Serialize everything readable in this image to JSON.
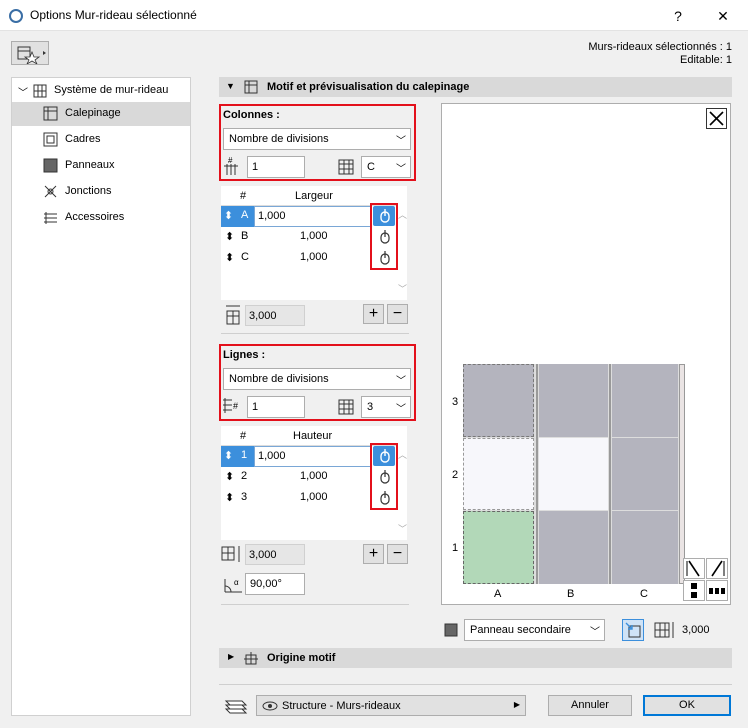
{
  "window": {
    "title": "Options Mur-rideau sélectionné",
    "help": "?",
    "close": "✕"
  },
  "header": {
    "selected": "Murs-rideaux sélectionnés : 1",
    "editable": "Editable: 1"
  },
  "sidebar": {
    "root": "Système de mur-rideau",
    "items": [
      {
        "label": "Calepinage"
      },
      {
        "label": "Cadres"
      },
      {
        "label": "Panneaux"
      },
      {
        "label": "Jonctions"
      },
      {
        "label": "Accessoires"
      }
    ]
  },
  "section": {
    "title": "Motif et prévisualisation du calepinage"
  },
  "columns": {
    "label": "Colonnes :",
    "mode": "Nombre de divisions",
    "count": "1",
    "ref": "C",
    "col_num": "#",
    "col_width": "Largeur",
    "rows": [
      {
        "arrow": "⬍",
        "id": "A",
        "value": "1,000"
      },
      {
        "arrow": "⬍",
        "id": "B",
        "value": "1,000"
      },
      {
        "arrow": "⬍",
        "id": "C",
        "value": "1,000"
      }
    ],
    "total": "3,000"
  },
  "lines": {
    "label": "Lignes :",
    "mode": "Nombre de divisions",
    "count": "1",
    "ref": "3",
    "col_num": "#",
    "col_height": "Hauteur",
    "rows": [
      {
        "arrow": "⬍",
        "id": "1",
        "value": "1,000"
      },
      {
        "arrow": "⬍",
        "id": "2",
        "value": "1,000"
      },
      {
        "arrow": "⬍",
        "id": "3",
        "value": "1,000"
      }
    ],
    "total": "3,000",
    "angle": "90,00°"
  },
  "preview": {
    "row_labels": [
      "3",
      "2",
      "1"
    ],
    "col_labels": [
      "A",
      "B",
      "C"
    ],
    "panel_type": "Panneau secondaire",
    "total": "3,000"
  },
  "origin": {
    "title": "Origine motif"
  },
  "footer": {
    "layer": "Structure - Murs-rideaux",
    "cancel": "Annuler",
    "ok": "OK"
  },
  "colors": {
    "panel_gray": "#b4b4be",
    "panel_white": "#f7f7fb",
    "panel_green": "#b2d8b8",
    "accent": "#3c8fdc",
    "red": "#e3101b"
  }
}
